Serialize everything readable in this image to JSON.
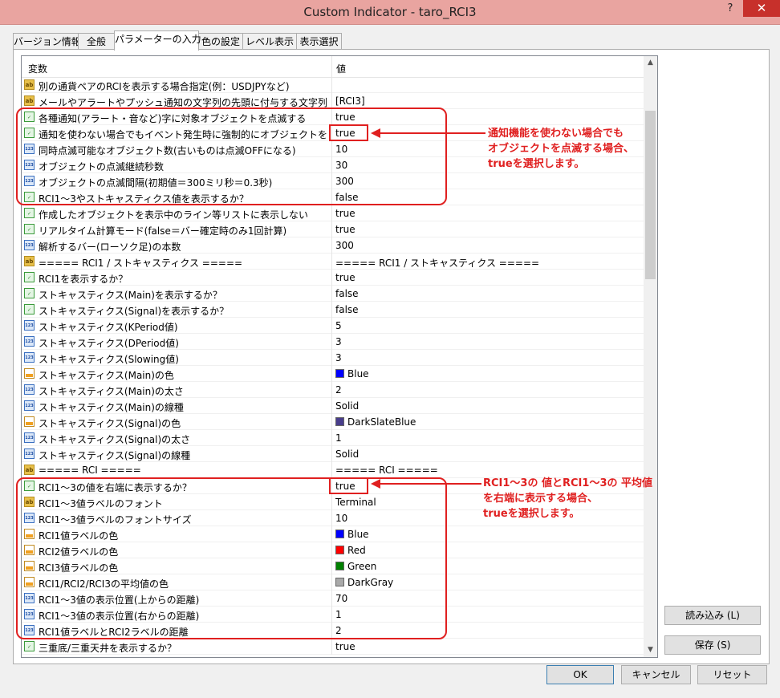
{
  "window": {
    "title": "Custom Indicator - taro_RCI3",
    "help": "?",
    "close": "✕"
  },
  "tabs": [
    "バージョン情報",
    "全般",
    "パラメーターの入力",
    "色の設定",
    "レベル表示",
    "表示選択"
  ],
  "grid": {
    "header_name": "変数",
    "header_value": "値",
    "rows": [
      {
        "type": "ab",
        "name": "別の通貨ペアのRCIを表示する場合指定(例：USDJPYなど)",
        "value": ""
      },
      {
        "type": "ab",
        "name": "メールやアラートやプッシュ通知の文字列の先頭に付与する文字列",
        "value": "[RCI3]"
      },
      {
        "type": "bool",
        "name": "各種通知(アラート・音など)字に対象オブジェクトを点滅する",
        "value": "true"
      },
      {
        "type": "bool",
        "name": "通知を使わない場合でもイベント発生時に強制的にオブジェクトを点滅する",
        "value": "true"
      },
      {
        "type": "num",
        "name": "同時点滅可能なオブジェクト数(古いものは点滅OFFになる)",
        "value": "10"
      },
      {
        "type": "num",
        "name": "オブジェクトの点滅継続秒数",
        "value": "30"
      },
      {
        "type": "num",
        "name": "オブジェクトの点滅間隔(初期値＝300ミリ秒＝0.3秒)",
        "value": "300"
      },
      {
        "type": "bool",
        "name": "RCI1～3やストキャスティクス値を表示するか？",
        "value": "false"
      },
      {
        "type": "bool",
        "name": "作成したオブジェクトを表示中のライン等リストに表示しない",
        "value": "true"
      },
      {
        "type": "bool",
        "name": "リアルタイム計算モード(false＝バー確定時のみ1回計算)",
        "value": "true"
      },
      {
        "type": "num",
        "name": "解析するバー(ローソク足)の本数",
        "value": "300"
      },
      {
        "type": "ab",
        "name": "===== RCI1 / ストキャスティクス =====",
        "value": "===== RCI1 / ストキャスティクス ====="
      },
      {
        "type": "bool",
        "name": "RCI1を表示するか？",
        "value": "true"
      },
      {
        "type": "bool",
        "name": "ストキャスティクス(Main)を表示するか？",
        "value": "false"
      },
      {
        "type": "bool",
        "name": "ストキャスティクス(Signal)を表示するか？",
        "value": "false"
      },
      {
        "type": "num",
        "name": "ストキャスティクス(KPeriod値)",
        "value": "5"
      },
      {
        "type": "num",
        "name": "ストキャスティクス(DPeriod値)",
        "value": "3"
      },
      {
        "type": "num",
        "name": "ストキャスティクス(Slowing値)",
        "value": "3"
      },
      {
        "type": "color",
        "name": "ストキャスティクス(Main)の色",
        "value": "Blue",
        "swatch": "#0000ff"
      },
      {
        "type": "num",
        "name": "ストキャスティクス(Main)の太さ",
        "value": "2"
      },
      {
        "type": "num",
        "name": "ストキャスティクス(Main)の線種",
        "value": "Solid"
      },
      {
        "type": "color",
        "name": "ストキャスティクス(Signal)の色",
        "value": "DarkSlateBlue",
        "swatch": "#483d8b"
      },
      {
        "type": "num",
        "name": "ストキャスティクス(Signal)の太さ",
        "value": "1"
      },
      {
        "type": "num",
        "name": "ストキャスティクス(Signal)の線種",
        "value": "Solid"
      },
      {
        "type": "ab",
        "name": "===== RCI =====",
        "value": "===== RCI ====="
      },
      {
        "type": "bool",
        "name": "RCI1～3の値を右端に表示するか？",
        "value": "true"
      },
      {
        "type": "ab",
        "name": "RCI1～3値ラベルのフォント",
        "value": "Terminal"
      },
      {
        "type": "num",
        "name": "RCI1～3値ラベルのフォントサイズ",
        "value": "10"
      },
      {
        "type": "color",
        "name": "RCI1値ラベルの色",
        "value": "Blue",
        "swatch": "#0000ff"
      },
      {
        "type": "color",
        "name": "RCI2値ラベルの色",
        "value": "Red",
        "swatch": "#ff0000"
      },
      {
        "type": "color",
        "name": "RCI3値ラベルの色",
        "value": "Green",
        "swatch": "#008000"
      },
      {
        "type": "color",
        "name": "RCI1/RCI2/RCI3の平均値の色",
        "value": "DarkGray",
        "swatch": "#a9a9a9"
      },
      {
        "type": "num",
        "name": "RCI1～3値の表示位置(上からの距離)",
        "value": "70"
      },
      {
        "type": "num",
        "name": "RCI1～3値の表示位置(右からの距離)",
        "value": "1"
      },
      {
        "type": "num",
        "name": "RCI1値ラベルとRCI2ラベルの距離",
        "value": "2"
      },
      {
        "type": "bool",
        "name": "三重底/三重天井を表示するか？",
        "value": "true"
      }
    ]
  },
  "annotations": {
    "note1": [
      "通知機能を使わない場合でも",
      "オブジェクトを点滅する場合、",
      "trueを選択します。"
    ],
    "note2": [
      "RCI1～3の 値とRCI1～3の 平均値",
      "を右端に表示する場合、",
      "trueを選択します。"
    ],
    "color": "#e02020"
  },
  "buttons": {
    "load": "読み込み (L)",
    "save": "保存 (S)",
    "ok": "OK",
    "cancel": "キャンセル",
    "reset": "リセット"
  }
}
